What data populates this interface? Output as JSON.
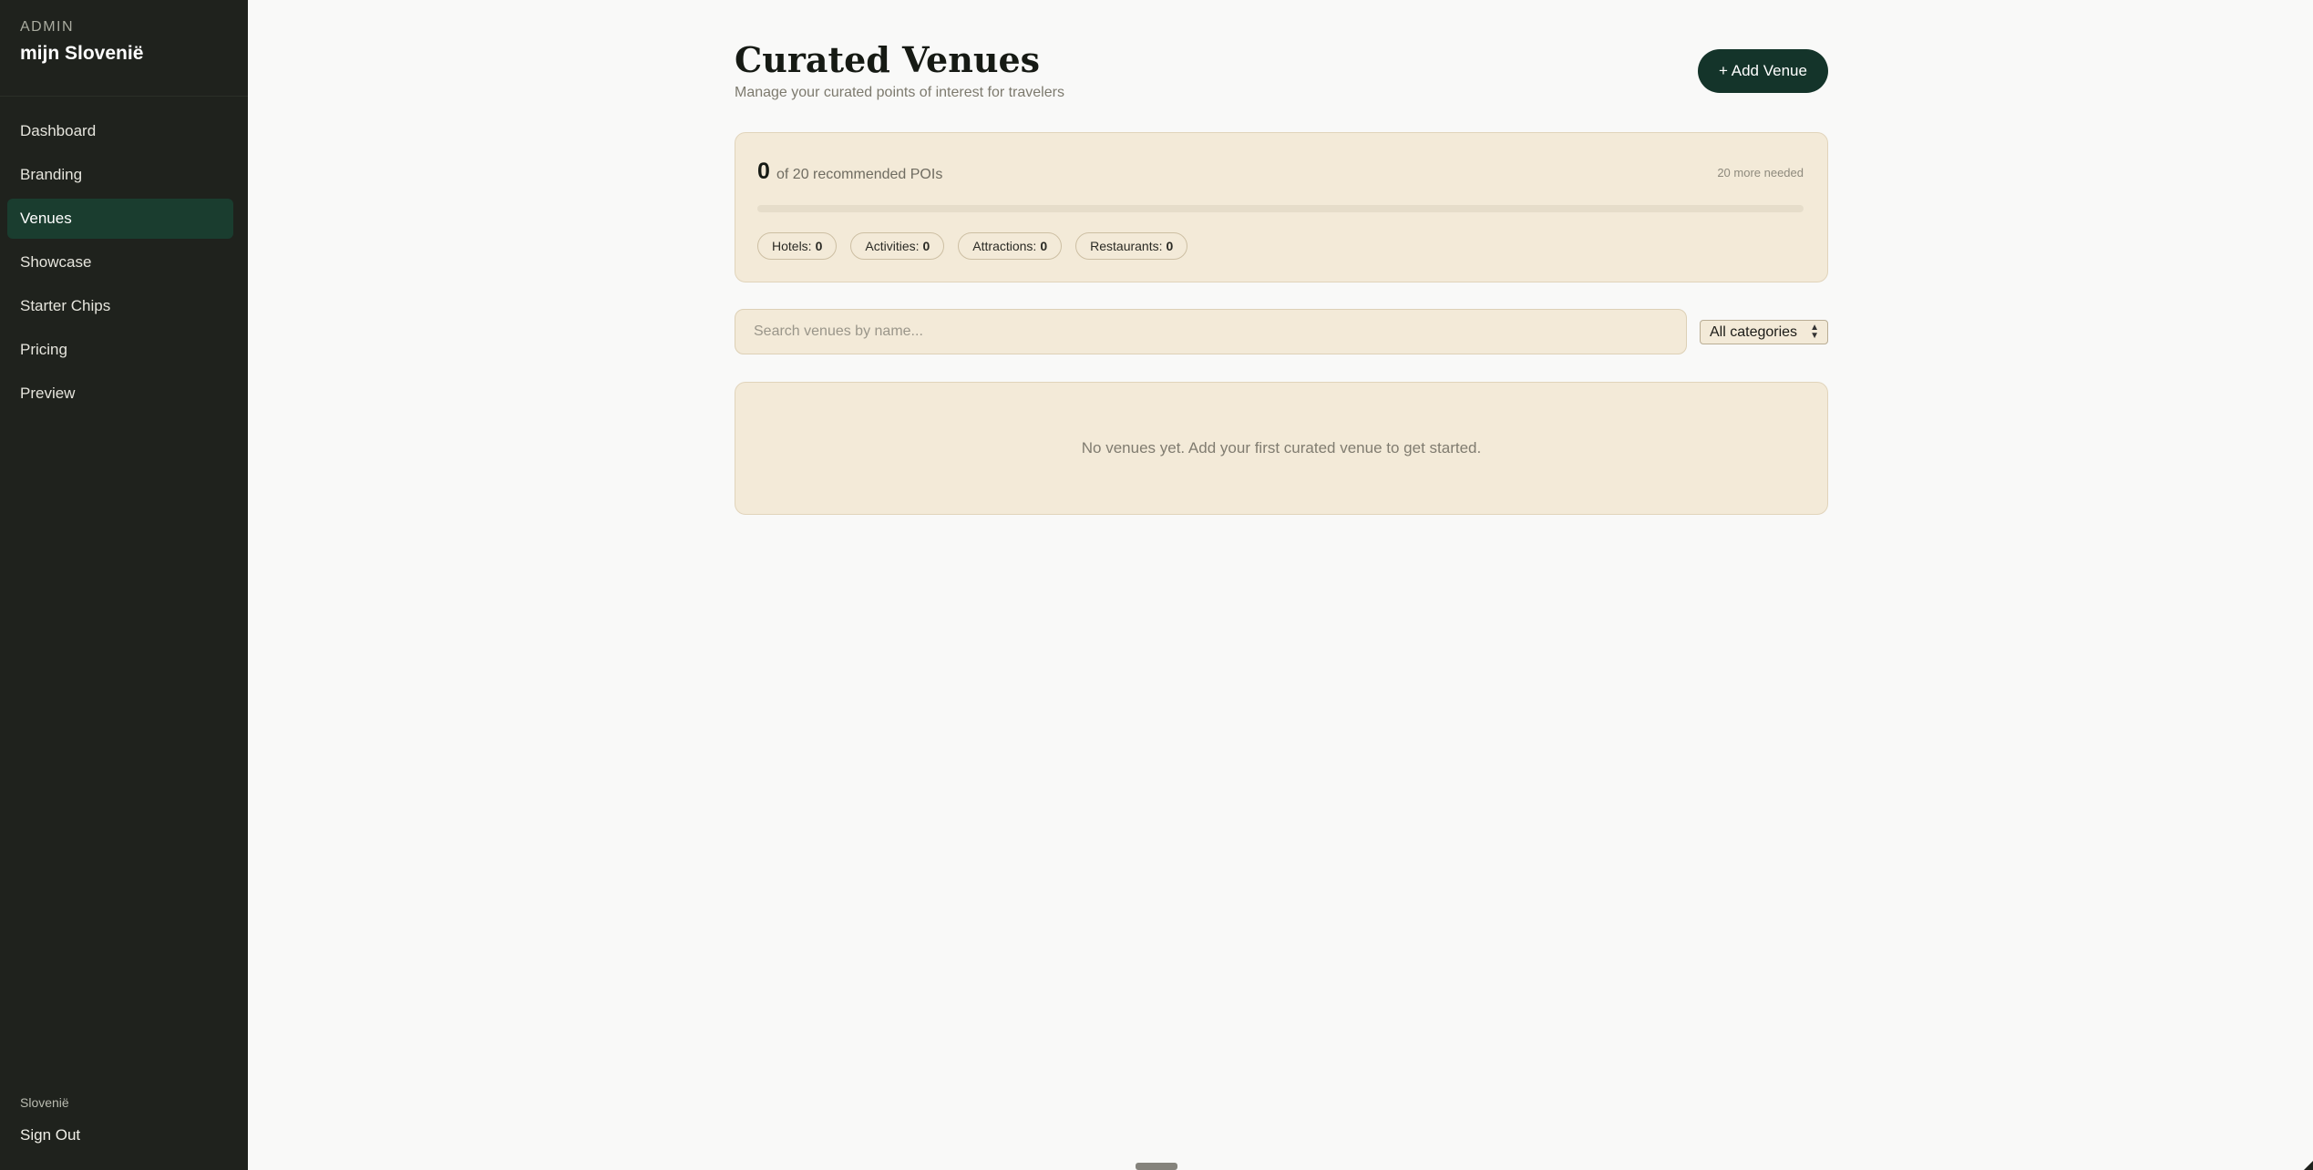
{
  "sidebar": {
    "admin_label": "ADMIN",
    "site_title": "mijn Slovenië",
    "nav": [
      {
        "label": "Dashboard",
        "active": false
      },
      {
        "label": "Branding",
        "active": false
      },
      {
        "label": "Venues",
        "active": true
      },
      {
        "label": "Showcase",
        "active": false
      },
      {
        "label": "Starter Chips",
        "active": false
      },
      {
        "label": "Pricing",
        "active": false
      },
      {
        "label": "Preview",
        "active": false
      }
    ],
    "country": "Slovenië",
    "sign_out": "Sign Out"
  },
  "header": {
    "title": "Curated Venues",
    "subtitle": "Manage your curated points of interest for travelers",
    "add_button": "+ Add Venue"
  },
  "stats": {
    "count": "0",
    "of_text": "of 20 recommended POIs",
    "needed_text": "20 more needed",
    "progress_fraction": 0,
    "chips": [
      {
        "label": "Hotels:",
        "value": "0"
      },
      {
        "label": "Activities:",
        "value": "0"
      },
      {
        "label": "Attractions:",
        "value": "0"
      },
      {
        "label": "Restaurants:",
        "value": "0"
      }
    ]
  },
  "search": {
    "placeholder": "Search venues by name...",
    "value": ""
  },
  "category_select": {
    "selected": "All categories"
  },
  "empty_state": {
    "message": "No venues yet. Add your first curated venue to get started."
  },
  "colors": {
    "sidebar_bg": "#1f221d",
    "accent": "#14342a",
    "card_bg": "#f3ead8"
  }
}
